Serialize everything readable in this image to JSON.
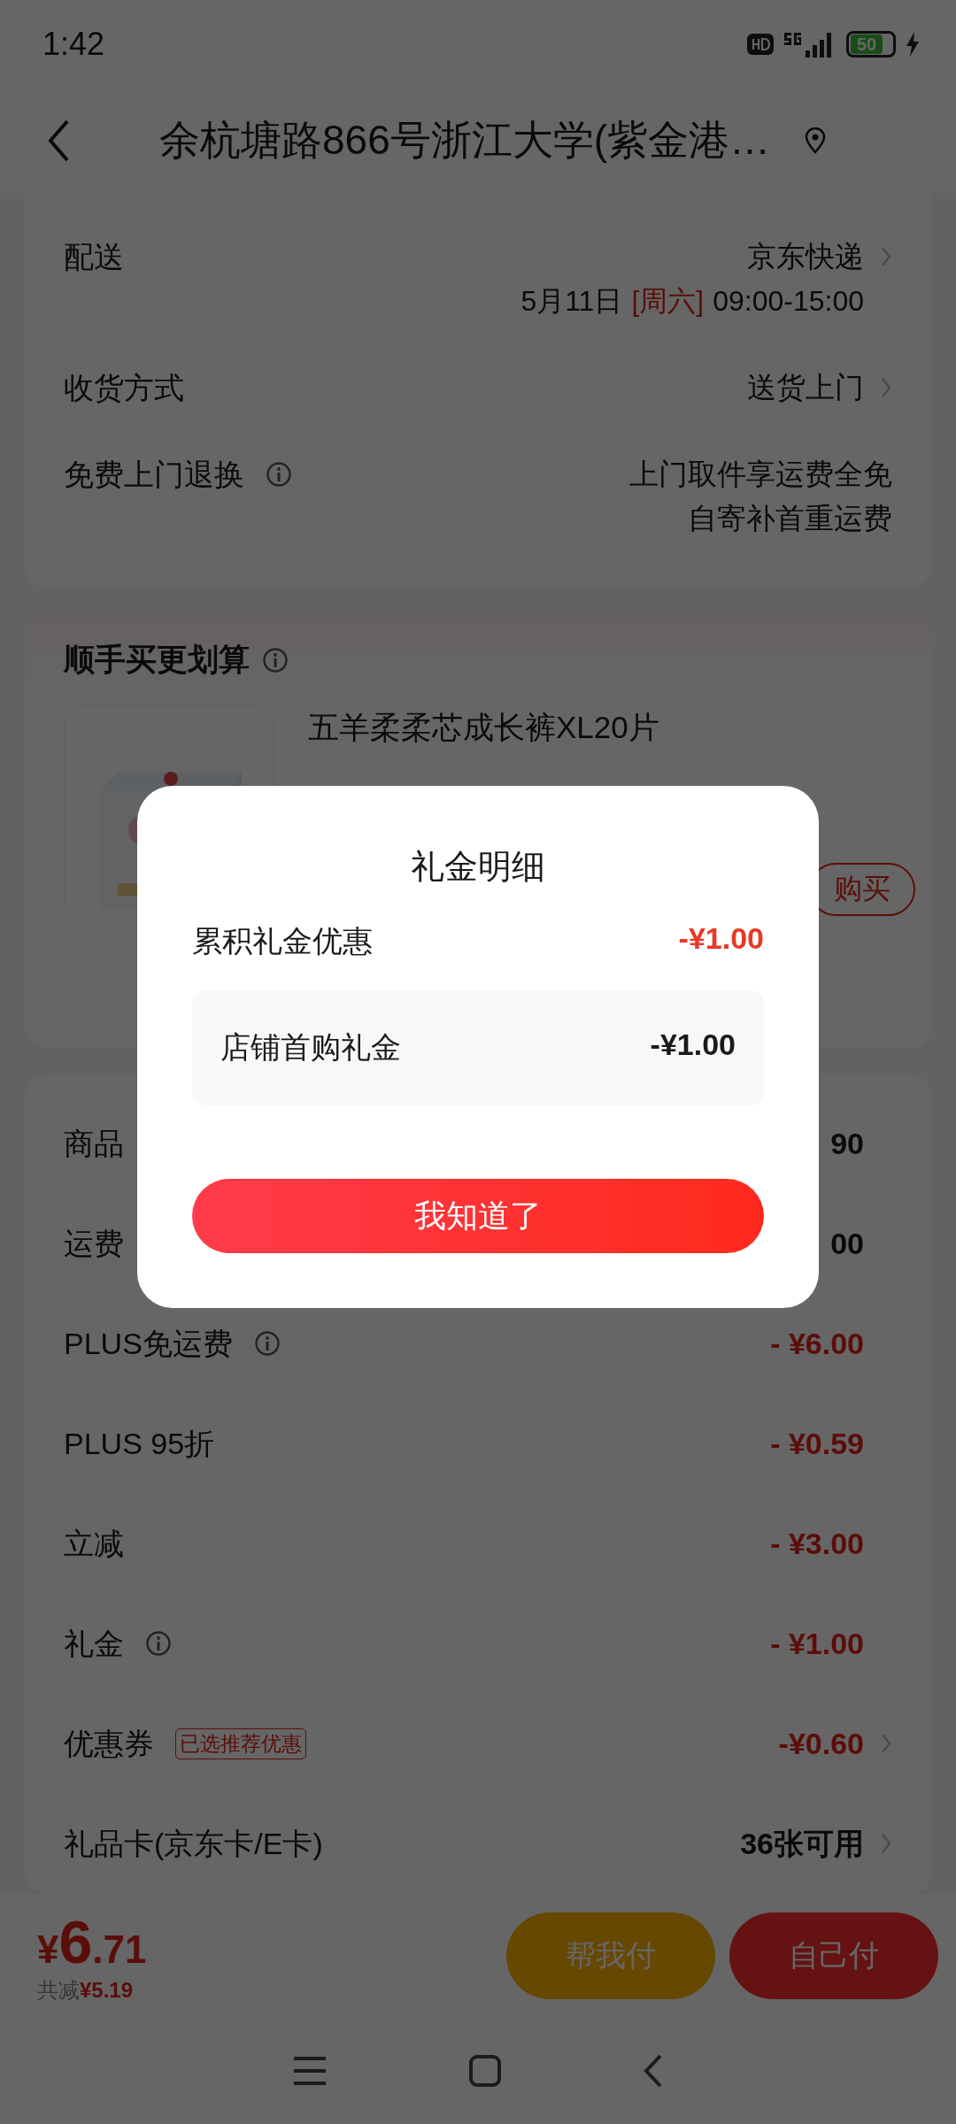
{
  "status_bar": {
    "time": "1:42",
    "battery": "50"
  },
  "header": {
    "title": "余杭塘路866号浙江大学(紫金港…"
  },
  "delivery_card": {
    "rows": [
      {
        "label": "配送",
        "info": false,
        "arrow": true,
        "lines": [
          "京东快递"
        ],
        "schedule": {
          "date": "5月11日",
          "weekday": "[周六]",
          "time": "09:00-15:00"
        }
      },
      {
        "label": "收货方式",
        "info": false,
        "arrow": true,
        "lines": [
          "送货上门"
        ]
      },
      {
        "label": "免费上门退换",
        "info": true,
        "arrow": false,
        "lines": [
          "上门取件享运费全免",
          "自寄补首重运费"
        ]
      }
    ]
  },
  "addon_card": {
    "title": "顺手买更划算",
    "info": true,
    "product": {
      "kind": "picture",
      "name": "五羊柔柔芯成长裤XL20片",
      "button": "购买"
    }
  },
  "fees": [
    {
      "kind": "plain",
      "label": "商品",
      "value": "90",
      "info": false,
      "arrow": false
    },
    {
      "kind": "plain",
      "label": "运费",
      "value": "00",
      "info": false,
      "arrow": false
    },
    {
      "kind": "discount",
      "label": "PLUS免运费",
      "value": "- ¥6.00",
      "info": true,
      "arrow": false
    },
    {
      "kind": "discount",
      "label": "PLUS 95折",
      "value": "- ¥0.59",
      "info": false,
      "arrow": false
    },
    {
      "kind": "discount",
      "label": "立减",
      "value": "- ¥3.00",
      "info": false,
      "arrow": false
    },
    {
      "kind": "discount",
      "label": "礼金",
      "value": "- ¥1.00",
      "info": true,
      "arrow": false
    },
    {
      "kind": "discount",
      "label": "优惠券",
      "tag": "已选推荐优惠",
      "value": "-¥0.60",
      "info": false,
      "arrow": true
    },
    {
      "kind": "plain",
      "label": "礼品卡(京东卡/E卡)",
      "value": "36张可用",
      "info": false,
      "arrow": true
    }
  ],
  "bottom_bar": {
    "currency": "¥",
    "integer": "6",
    "decimal": ".71",
    "saved_label": "共减",
    "saved": "¥5.19",
    "buttons": [
      {
        "label": "帮我付",
        "kind": "friend"
      },
      {
        "label": "自己付",
        "kind": "self"
      }
    ]
  },
  "dialog": {
    "title": "礼金明细",
    "summary": {
      "label": "累积礼金优惠",
      "value": "-¥1.00"
    },
    "items": [
      {
        "label": "店铺首购礼金",
        "value": "-¥1.00"
      }
    ],
    "button": "我知道了"
  }
}
